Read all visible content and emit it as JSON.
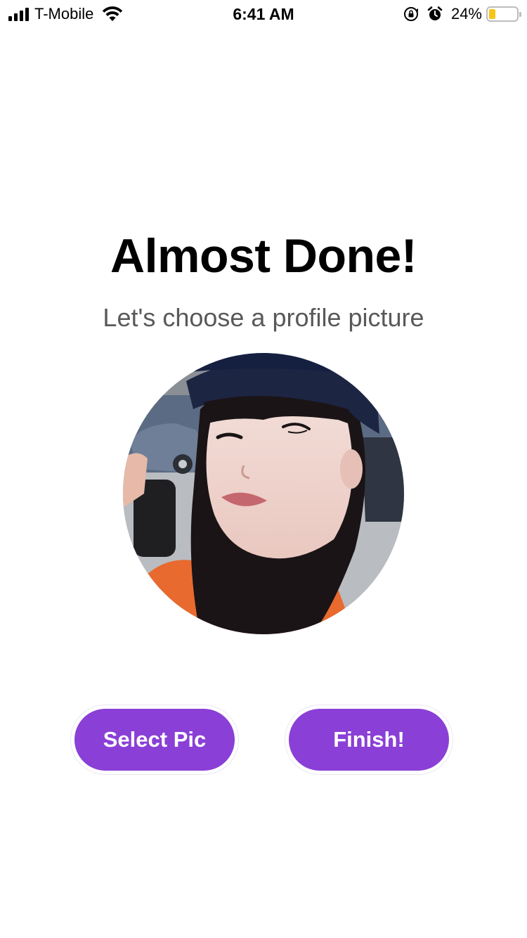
{
  "status_bar": {
    "carrier": "T-Mobile",
    "time": "6:41 AM",
    "battery_percent": "24%",
    "battery_level": 0.24,
    "icons": [
      "signal-icon",
      "wifi-icon",
      "rotation-lock-icon",
      "alarm-icon",
      "battery-icon"
    ]
  },
  "main": {
    "title": "Almost Done!",
    "subtitle": "Let's choose a profile picture"
  },
  "buttons": {
    "select_pic": "Select Pic",
    "finish": "Finish!"
  },
  "colors": {
    "button_bg": "#8a3fd6",
    "subtitle": "#595959",
    "battery_fill": "#f5c518"
  }
}
